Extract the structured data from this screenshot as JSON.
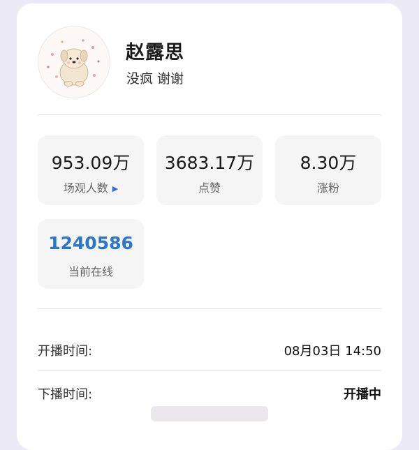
{
  "profile": {
    "name": "赵露思",
    "bio": "没疯 谢谢",
    "avatar_icon": "puppy-avatar-icon"
  },
  "stats": [
    {
      "value": "953.09万",
      "label": "场观人数",
      "has_arrow": true
    },
    {
      "value": "3683.17万",
      "label": "点赞"
    },
    {
      "value": "8.30万",
      "label": "涨粉"
    },
    {
      "value": "1240586",
      "label": "当前在线",
      "value_color": "#2a76c8"
    }
  ],
  "info": {
    "start_label": "开播时间:",
    "start_value": "08月03日 14:50",
    "end_label": "下播时间:",
    "end_value": "开播中"
  },
  "colors": {
    "background": "#eceaf6",
    "card": "#ffffff",
    "tile": "#f5f5f6",
    "online_accent": "#2a76c8",
    "arrow": "#2d6cf0"
  }
}
